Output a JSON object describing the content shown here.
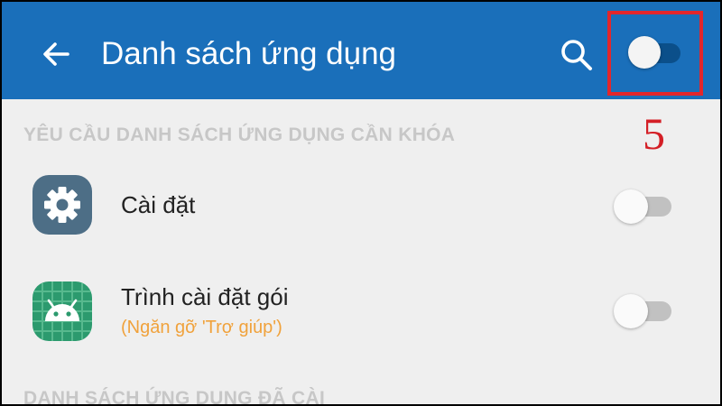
{
  "header": {
    "title": "Danh sách ứng dụng",
    "back_icon": "arrow-left-icon",
    "search_icon": "search-icon",
    "master_toggle_on": false,
    "color": "#1a6fba"
  },
  "annotation": {
    "label": "5",
    "color": "#e3262b"
  },
  "sections": [
    {
      "title": "YÊU CẦU DANH SÁCH ỨNG DỤNG CẦN KHÓA",
      "apps": [
        {
          "name": "Cài đặt",
          "icon": "gear-icon",
          "icon_color": "#4d6e86",
          "enabled": false
        },
        {
          "name": "Trình cài đặt gói",
          "subtitle": "(Ngăn gỡ 'Trợ giúp')",
          "icon": "android-icon",
          "icon_color": "#2c9a6e",
          "enabled": false
        }
      ]
    },
    {
      "title": "DANH SÁCH ỨNG DỤNG ĐÃ CÀI"
    }
  ]
}
